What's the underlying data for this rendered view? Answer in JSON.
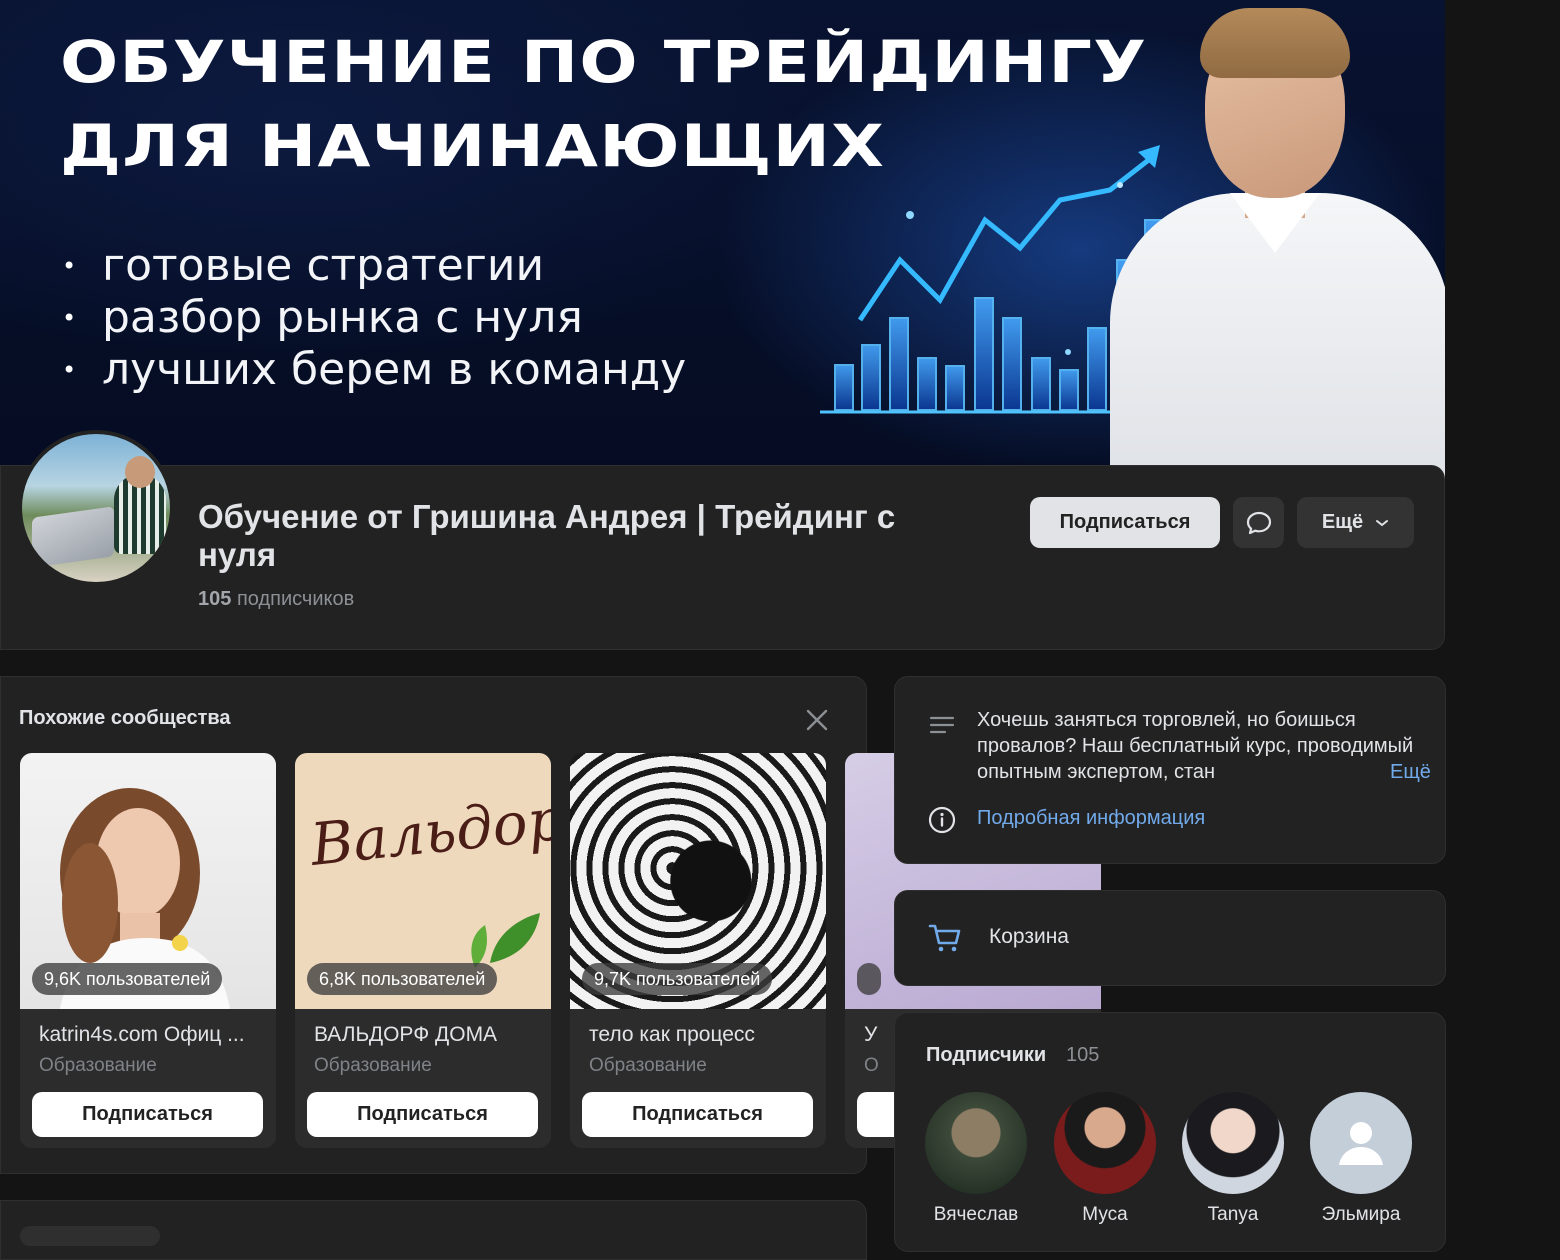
{
  "cover": {
    "title_line1": "ОБУЧЕНИЕ ПО ТРЕЙДИНГУ",
    "title_line2": "ДЛЯ НАЧИНАЮЩИХ",
    "bullets": [
      "готовые стратегии",
      "разбор рынка с нуля",
      "лучших берем в команду"
    ],
    "accent_color": "#2f8cff"
  },
  "header": {
    "community_name": "Обучение от Гришина Андрея | Трейдинг с нуля",
    "subscribers_count": "105",
    "subscribers_label": "подписчиков",
    "subscribe_label": "Подписаться",
    "message_icon": "chat-bubble-icon",
    "more_label": "Ещё"
  },
  "similar": {
    "title": "Похожие сообщества",
    "items": [
      {
        "name": "katrin4s.com Офиц ...",
        "category": "Образование",
        "members": "9,6K пользователей",
        "button": "Подписаться"
      },
      {
        "name": "ВАЛЬДОРФ ДОМА",
        "category": "Образование",
        "members": "6,8K пользователей",
        "button": "Подписаться",
        "cover_text": "Вальдорф дома"
      },
      {
        "name": "тело как процесс",
        "category": "Образование",
        "members": "9,7K пользователей",
        "button": "Подписаться"
      },
      {
        "name": "У",
        "category": "О",
        "members": "",
        "button": ""
      }
    ]
  },
  "about": {
    "text": "Хочешь заняться торговлей, но боишься провалов? Наш бесплатный курс, проводимый опытным экспертом, стан",
    "more_label": "Ещё",
    "info_link": "Подробная информация"
  },
  "cart": {
    "label": "Корзина"
  },
  "followers": {
    "title": "Подписчики",
    "count": "105",
    "items": [
      {
        "name": "Вячеслав"
      },
      {
        "name": "Муса"
      },
      {
        "name": "Tanya"
      },
      {
        "name": "Эльмира"
      }
    ]
  }
}
